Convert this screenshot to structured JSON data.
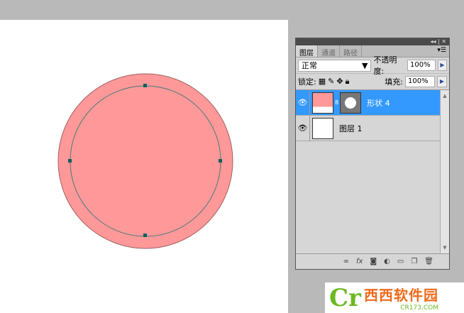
{
  "canvas": {
    "shape_color": "#ff9999",
    "path_color": "#4a7a7a"
  },
  "panel": {
    "tabs": [
      "图层",
      "通道",
      "路径"
    ],
    "blend_mode": "正常",
    "opacity_label": "不透明度:",
    "opacity": "100%",
    "lock_label": "锁定:",
    "fill_label": "填充:",
    "fill": "100%",
    "layers": [
      {
        "name": "形状 4",
        "selected": true
      },
      {
        "name": "图层 1",
        "selected": false
      }
    ],
    "footer_icons": [
      "link-icon",
      "fx-icon",
      "mask-icon",
      "adjustment-icon",
      "folder-icon",
      "new-layer-icon",
      "trash-icon"
    ]
  },
  "watermark": {
    "brand": "西西软件园",
    "url": "CR173.COM"
  }
}
